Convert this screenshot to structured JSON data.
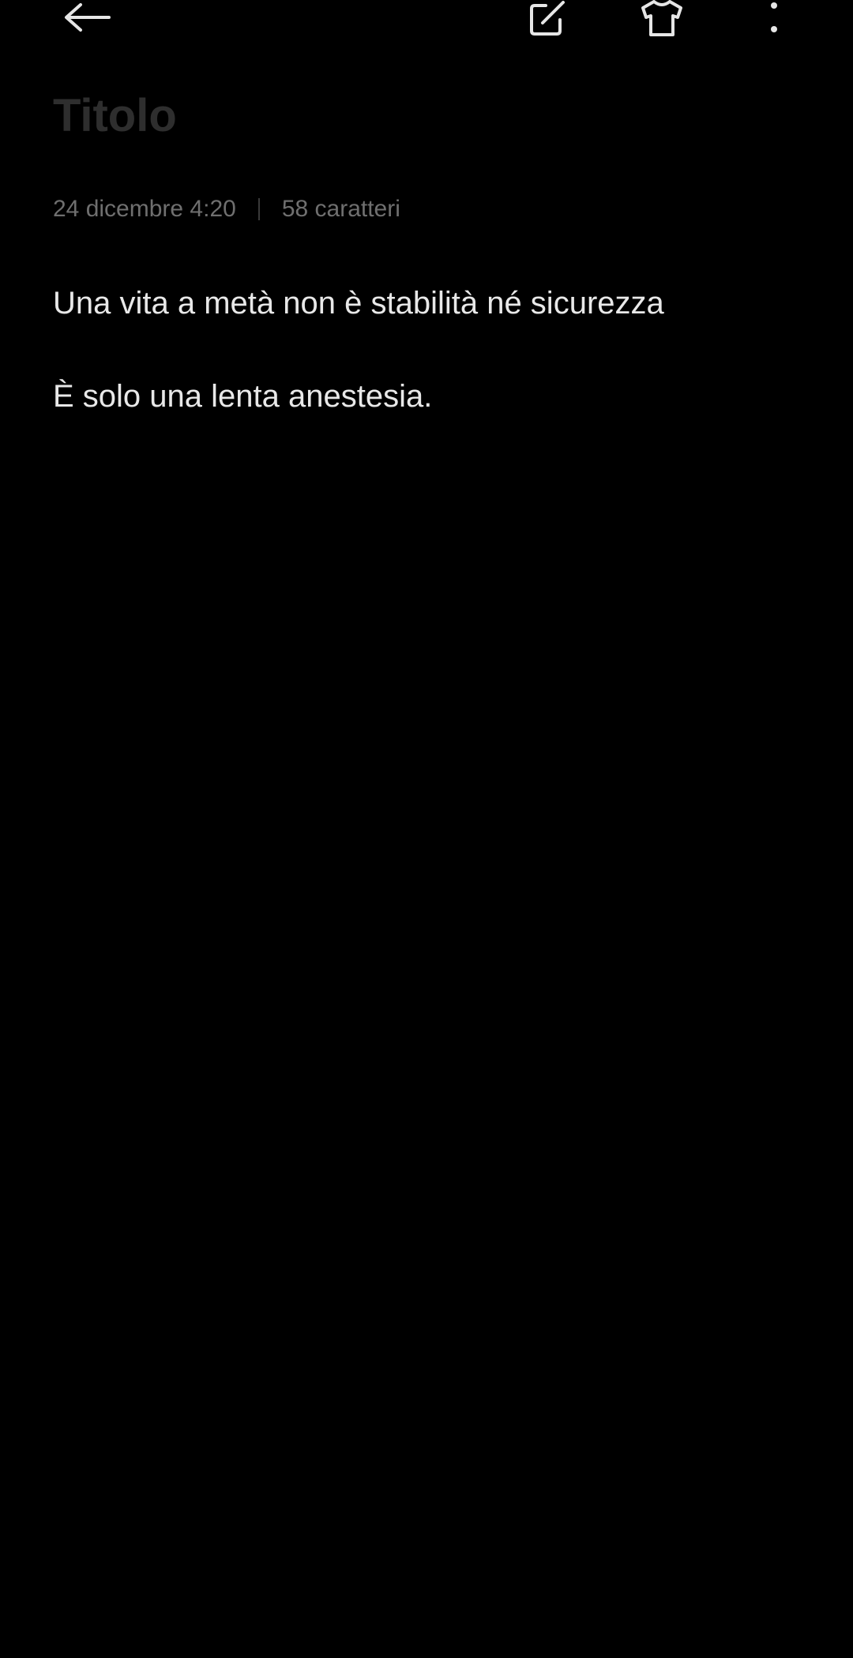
{
  "toolbar": {
    "back_icon": "arrow-left-icon",
    "edit_icon": "edit-square-icon",
    "skin_icon": "tshirt-icon",
    "more_icon": "more-vertical-icon"
  },
  "note": {
    "title_placeholder": "Titolo",
    "date": "24 dicembre 4:20",
    "char_count": "58 caratteri",
    "lines": [
      "Una vita a metà non è stabilità né sicurezza",
      "È solo una lenta anestesia."
    ]
  },
  "colors": {
    "background": "#000000",
    "text": "#e8e8e8",
    "meta": "#6f6f6f",
    "title_placeholder": "#2e2e2e"
  }
}
